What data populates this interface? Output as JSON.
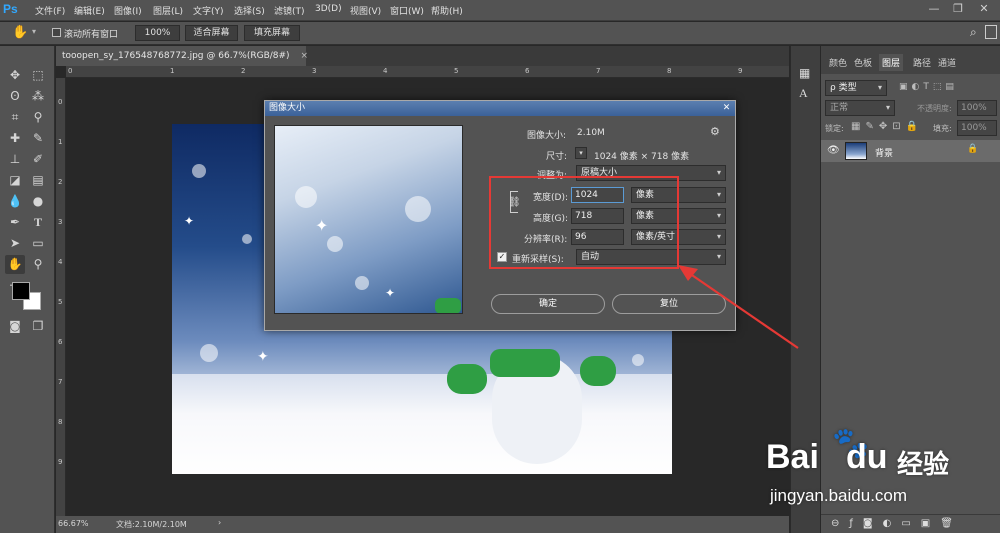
{
  "app": {
    "logo": "Ps"
  },
  "menu": [
    "文件(F)",
    "编辑(E)",
    "图像(I)",
    "图层(L)",
    "文字(Y)",
    "选择(S)",
    "滤镜(T)",
    "3D(D)",
    "视图(V)",
    "窗口(W)",
    "帮助(H)"
  ],
  "window_controls": {
    "minimize": "—",
    "restore": "❐",
    "close": "✕"
  },
  "options": {
    "scroll_all_label": "滚动所有窗口",
    "zoom_100": "100%",
    "fit_screen": "适合屏幕",
    "fill_screen": "填充屏幕"
  },
  "document": {
    "tab_title": "tooopen_sy_176548768772.jpg @ 66.7%(RGB/8#)",
    "tab_close": "×"
  },
  "ruler_ticks_h": [
    "0",
    "1",
    "2",
    "3",
    "4",
    "5",
    "6",
    "7",
    "8",
    "9",
    "1"
  ],
  "ruler_ticks_v": [
    "0",
    "1",
    "2",
    "3",
    "4",
    "5",
    "6",
    "7",
    "8",
    "9",
    "1"
  ],
  "status": {
    "zoom": "66.67%",
    "doc_info": "文档:2.10M/2.10M",
    "arrow": "›"
  },
  "panels": {
    "tabs": [
      "颜色",
      "色板",
      "图层",
      "路径",
      "通道"
    ],
    "active_tab": "图层",
    "kind_filter": "ρ 类型",
    "blend_mode": "正常",
    "opacity_label": "不透明度:",
    "opacity_value": "100%",
    "lock_label": "锁定:",
    "fill_label": "填充:",
    "fill_value": "100%",
    "layer_name": "背景"
  },
  "dialog": {
    "title": "图像大小",
    "close": "✕",
    "image_size_label": "图像大小:",
    "image_size_value": "2.10M",
    "dimensions_label": "尺寸:",
    "dimensions_value": "1024 像素 × 718 像素",
    "fit_to_label": "调整为:",
    "fit_to_value": "原稿大小",
    "width_label": "宽度(D):",
    "width_value": "1024",
    "width_unit": "像素",
    "height_label": "高度(G):",
    "height_value": "718",
    "height_unit": "像素",
    "resolution_label": "分辨率(R):",
    "resolution_value": "96",
    "resolution_unit": "像素/英寸",
    "resample_label": "重新采样(S):",
    "resample_checked": true,
    "resample_value": "自动",
    "ok_label": "确定",
    "reset_label": "复位"
  },
  "watermark": {
    "brand": "Bai",
    "brand2": "du",
    "cn": "经验",
    "url": "jingyan.baidu.com"
  },
  "colors": {
    "highlight": "#e53935",
    "accent": "#31a8ff",
    "dialog_title": "#3b6199"
  }
}
